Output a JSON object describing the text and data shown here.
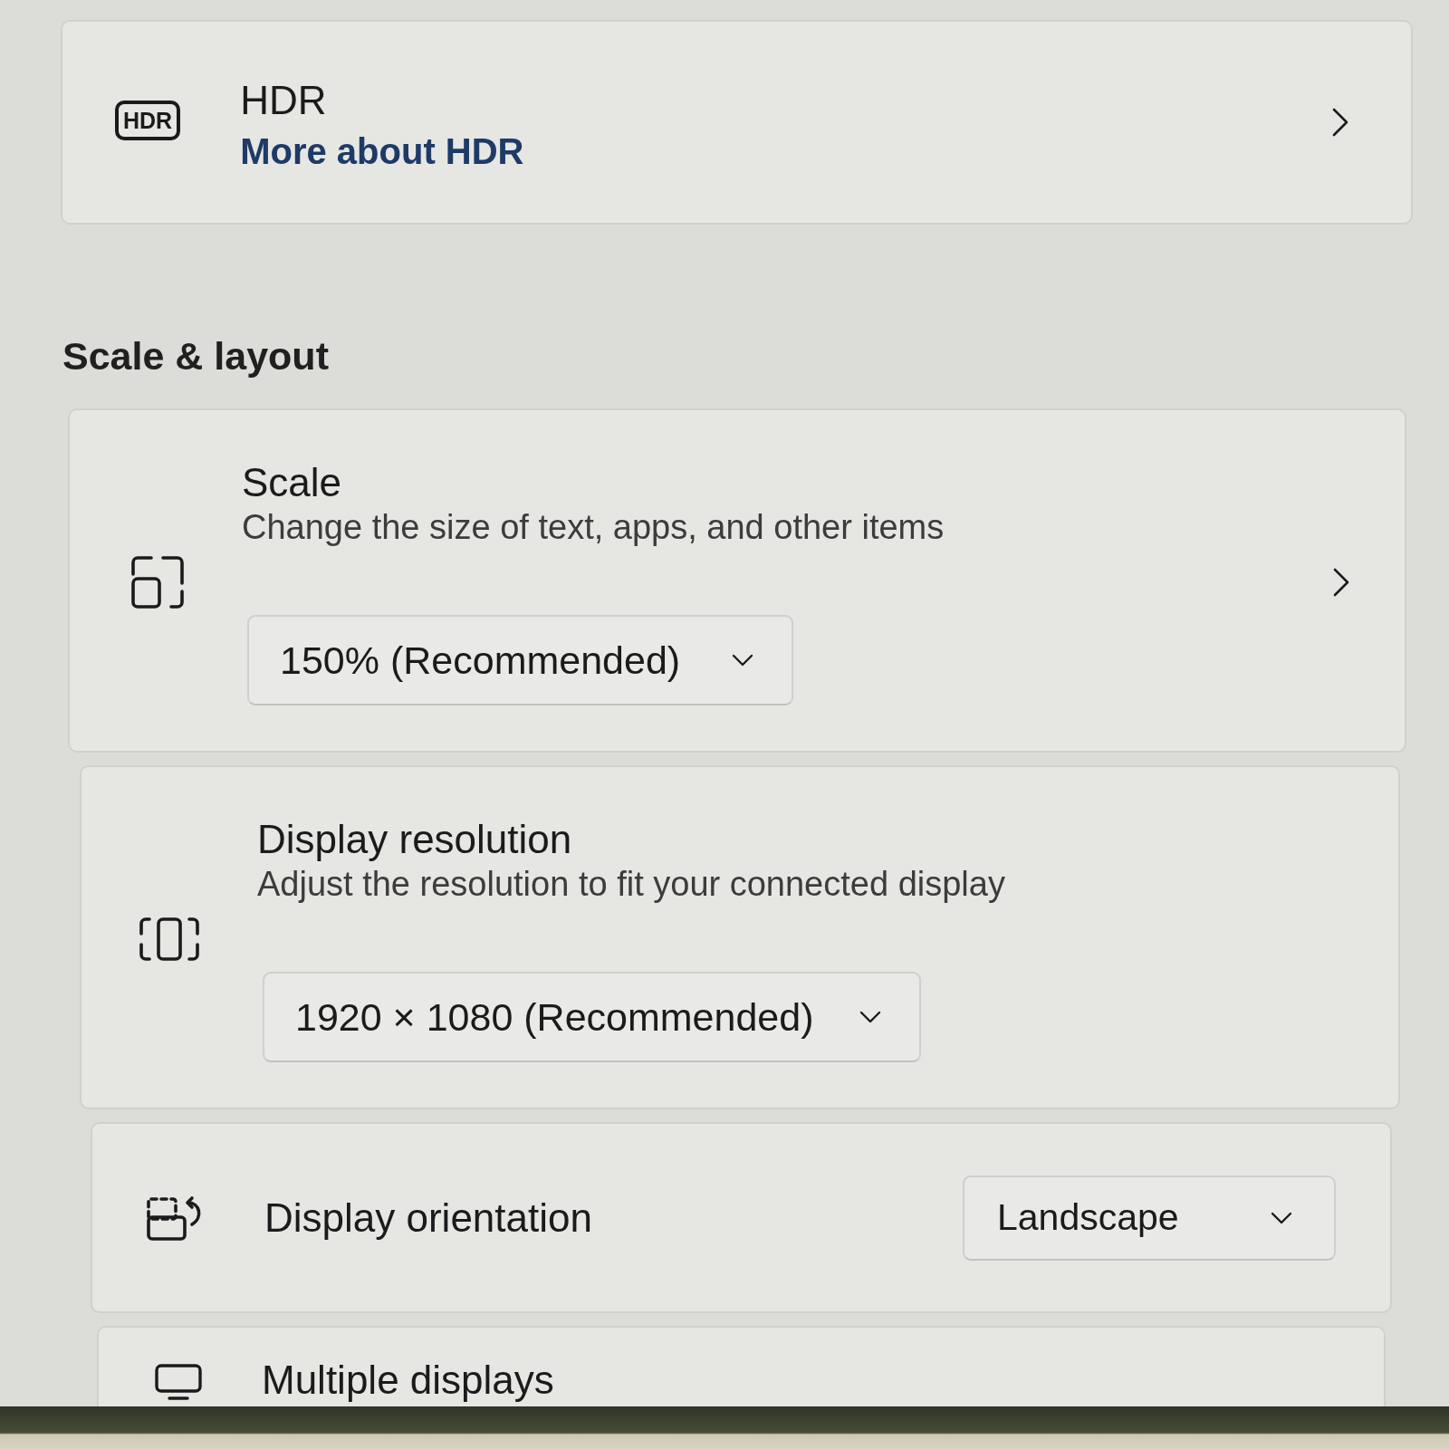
{
  "hdr": {
    "icon_label": "HDR",
    "title": "HDR",
    "link": "More about HDR",
    "chevron": true
  },
  "section": {
    "title": "Scale & layout"
  },
  "settings": [
    {
      "kind": "stacked",
      "title": "Scale",
      "description": "Change the size of text, apps, and other items",
      "value": "150% (Recommended)",
      "chevron": true
    },
    {
      "kind": "stacked",
      "title": "Display resolution",
      "description": "Adjust the resolution to fit your connected display",
      "value": "1920 × 1080 (Recommended)",
      "chevron": false
    },
    {
      "kind": "inline",
      "title": "Display orientation",
      "value": "Landscape",
      "chevron": false
    },
    {
      "kind": "header",
      "title": "Multiple displays",
      "chevron": false
    }
  ]
}
